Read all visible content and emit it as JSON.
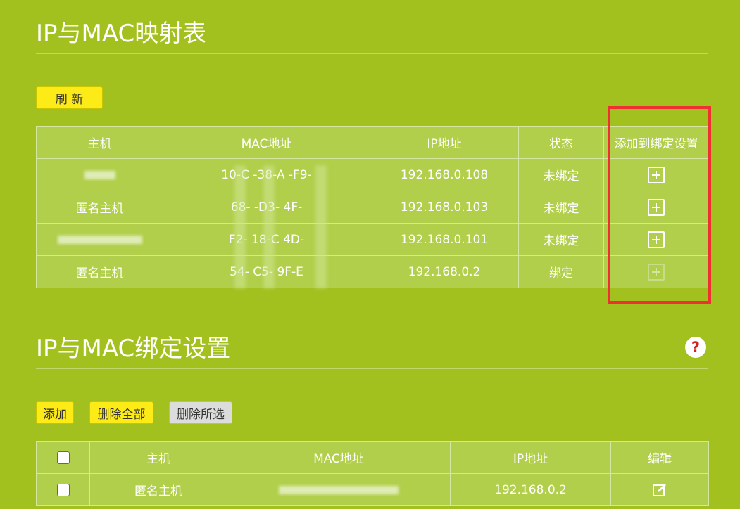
{
  "mapping_section": {
    "title": "IP与MAC映射表",
    "refresh_label": "刷 新",
    "headers": [
      "主机",
      "MAC地址",
      "IP地址",
      "状态",
      "添加到绑定设置"
    ],
    "rows": [
      {
        "host": "",
        "mac": "10-C -38-A -F9-",
        "ip": "192.168.0.108",
        "status": "未绑定",
        "add_enabled": true
      },
      {
        "host": "匿名主机",
        "mac": "68-  -D3-  4F-",
        "ip": "192.168.0.103",
        "status": "未绑定",
        "add_enabled": true
      },
      {
        "host": "",
        "mac": "F2-  18-C  4D-",
        "ip": "192.168.0.101",
        "status": "未绑定",
        "add_enabled": true
      },
      {
        "host": "匿名主机",
        "mac": "54-  C5-  9F-E",
        "ip": "192.168.0.2",
        "status": "绑定",
        "add_enabled": false
      }
    ]
  },
  "binding_section": {
    "title": "IP与MAC绑定设置",
    "add_label": "添加",
    "delete_all_label": "删除全部",
    "delete_selected_label": "删除所选",
    "headers": [
      "主机",
      "MAC地址",
      "IP地址",
      "编辑"
    ],
    "rows": [
      {
        "host": "匿名主机",
        "mac": "",
        "ip": "192.168.0.2"
      }
    ]
  },
  "colors": {
    "background": "#a2c11f",
    "highlight": "#f02f33",
    "button_yellow": "#fdeb18"
  },
  "icons": {
    "add": "plus-square-icon",
    "help": "help-icon",
    "edit": "edit-icon"
  },
  "help_glyph": "?"
}
